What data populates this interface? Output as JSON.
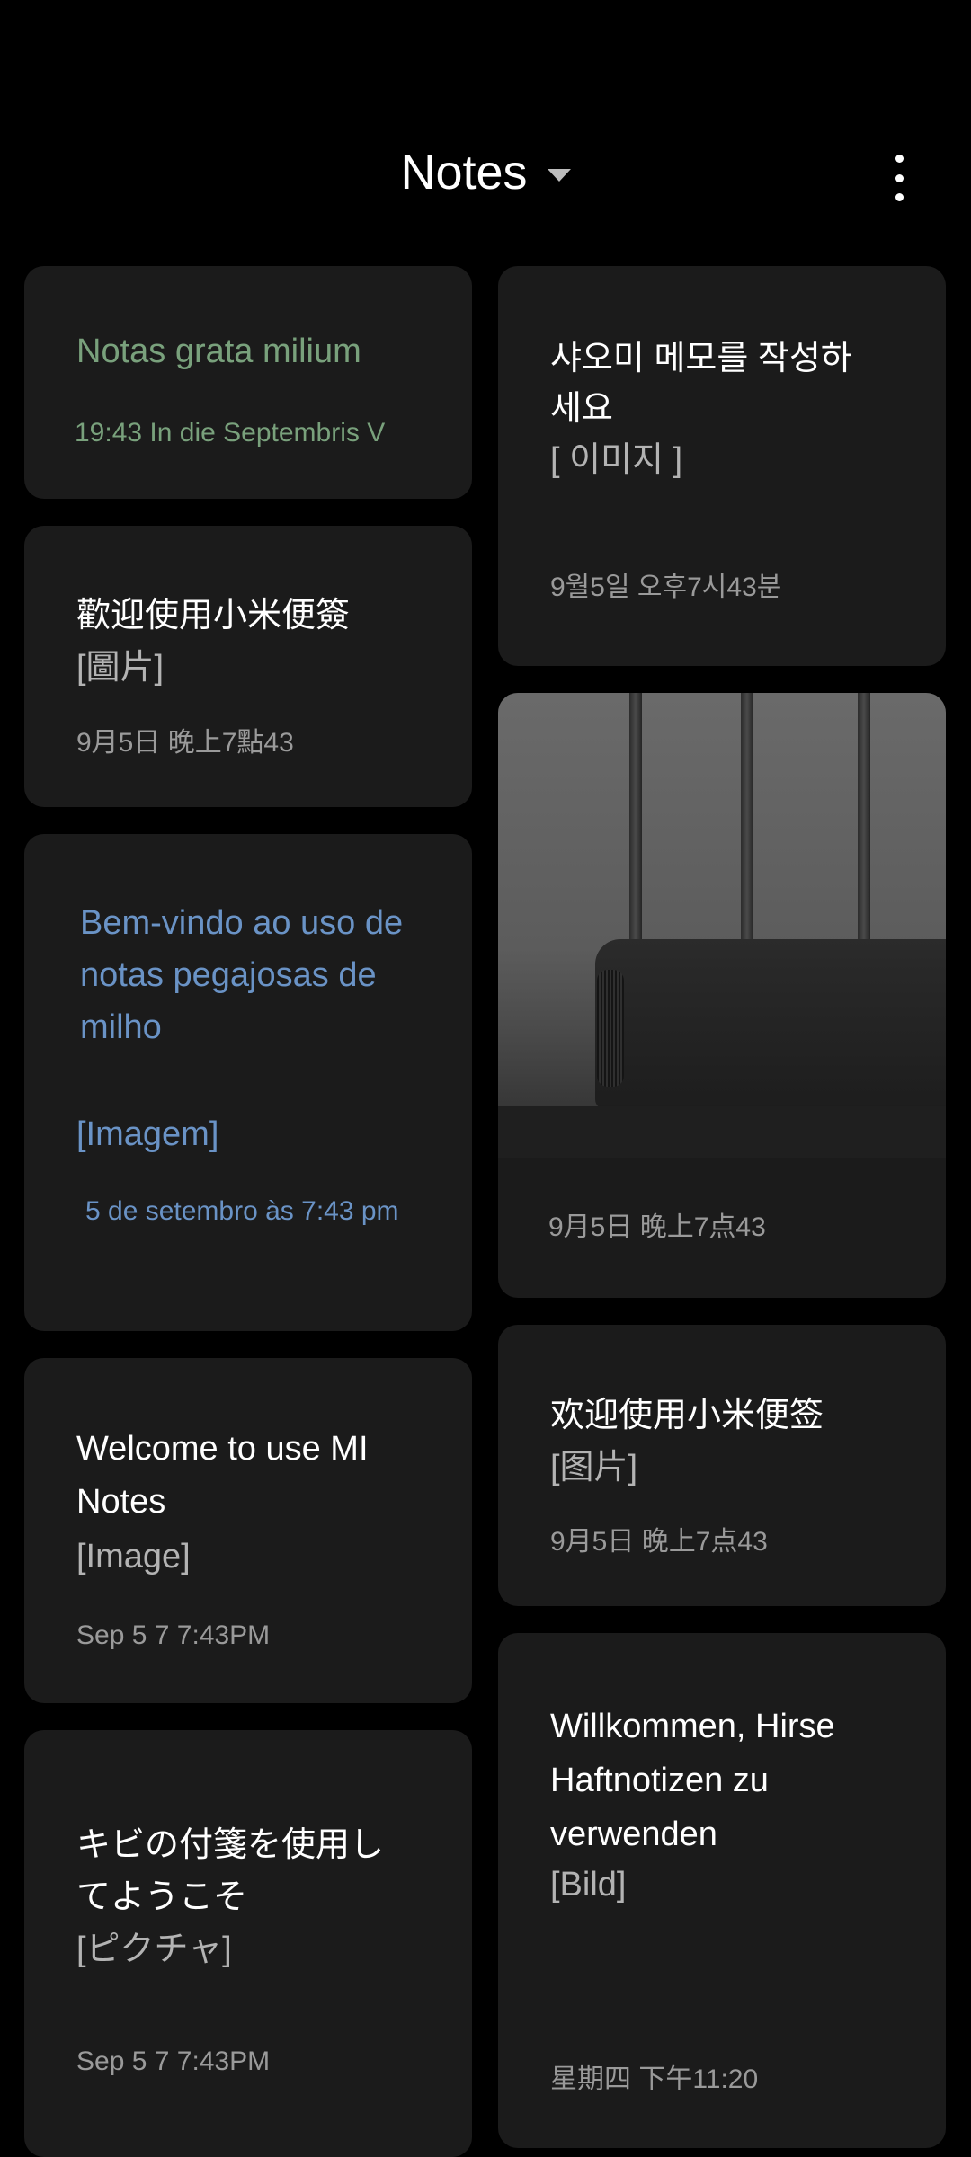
{
  "header": {
    "title": "Notes"
  },
  "notes_left": [
    {
      "title": "Notas grata milium",
      "attachment": "",
      "date": "19:43 In die Septembris V"
    },
    {
      "title": "歡迎使用小米便簽",
      "attachment": "[圖片]",
      "date": "9月5日 晚上7點43"
    },
    {
      "title_lines": [
        "Bem-vindo ao uso de",
        "notas pegajosas de",
        "milho"
      ],
      "attachment": "[Imagem]",
      "date": "5 de setembro às 7:43 pm"
    },
    {
      "title_lines": [
        "Welcome to use MI",
        "Notes"
      ],
      "attachment": "[Image]",
      "date": "Sep 5 7 7:43PM"
    },
    {
      "title_lines": [
        "キビの付箋を使用し",
        "てようこそ"
      ],
      "attachment": "[ピクチャ]",
      "date": "Sep 5 7 7:43PM"
    }
  ],
  "notes_right": [
    {
      "title_lines": [
        "샤오미 메모를 작성하",
        "세요"
      ],
      "attachment": "[ 이미지 ]",
      "date": "9월5일  오후7시43분"
    },
    {
      "title": "",
      "attachment": "",
      "date": "9月5日 晚上7点43"
    },
    {
      "title": "欢迎使用小米便签",
      "attachment": "[图片]",
      "date": "9月5日 晚上7点43"
    },
    {
      "title_lines": [
        "Willkommen, Hirse",
        "Haftnotizen zu",
        "verwenden"
      ],
      "attachment": "[Bild]",
      "date": "星期四 下午11:20"
    }
  ],
  "icons": {
    "dropdown": "caret-down-icon",
    "menu": "more-vertical-icon"
  },
  "colors": {
    "background": "#000000",
    "card": "#1b1b1b",
    "green_note": "#79a17c",
    "blue_note": "#6a93c6"
  }
}
